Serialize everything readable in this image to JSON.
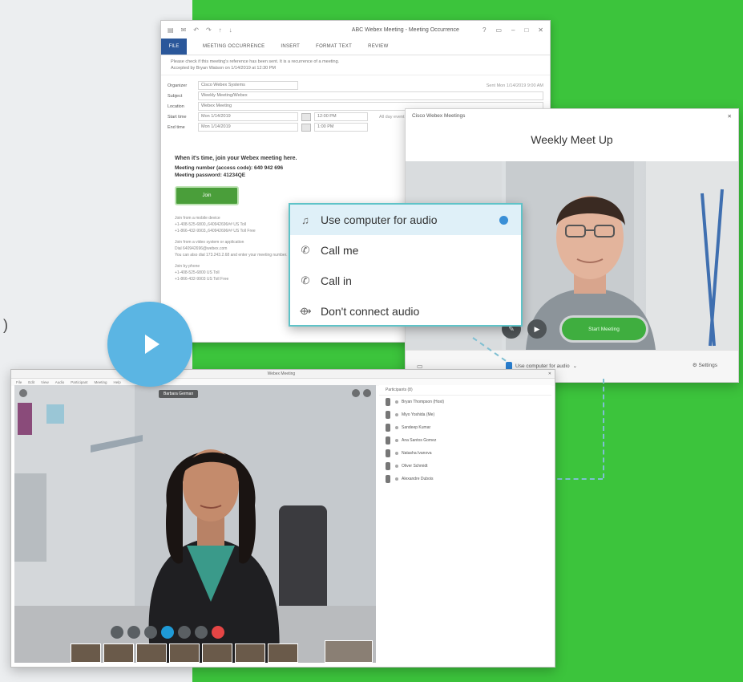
{
  "outlook": {
    "title": "ABC Webex Meeting  -  Meeting  Occurrence",
    "ribbon": {
      "file": "FILE",
      "tabs": [
        "MEETING OCCURRENCE",
        "INSERT",
        "FORMAT TEXT",
        "REVIEW"
      ]
    },
    "info_line1": "Please check if this meeting's reference has been sent. It is a recurrence of a meeting.",
    "info_line2": "Accepted by Bryan Watson on 1/14/2019 at 12:30 PM",
    "fields": [
      {
        "label": "Organizer",
        "value": "Cisco Webex Systems"
      },
      {
        "label": "Subject",
        "value": "Weekly Meeting/Webex"
      },
      {
        "label": "Location",
        "value": "Webex Meeting"
      }
    ],
    "start": {
      "label": "Start time",
      "date": "Mon 1/14/2019",
      "time": "12:00 PM",
      "extra": "All day event"
    },
    "end": {
      "label": "End time",
      "date": "Mon 1/14/2019",
      "time": "1:00 PM"
    },
    "sent": "Sent   Mon 1/14/2019 9:00 AM",
    "body": {
      "heading": "When it's time, join your Webex meeting here.",
      "meeting_number": "Meeting number (access code): 640 942 696",
      "meeting_password": "Meeting password: 41234QE",
      "join_label": "Join",
      "extra_lines": [
        "Join from a mobile device",
        "+1-408-525-6800,,640942696## US Toll",
        "+1-866-432-9903,,640942696## US Toll Free",
        "",
        "Join from a video system or application",
        "Dial 640942696@webex.com",
        "You can also dial 173.243.2.68 and enter your meeting number.",
        "",
        "Join by phone",
        "+1-408-525-6800 US Toll",
        "+1-866-432-9903 US Toll Free"
      ]
    }
  },
  "webex": {
    "window_title": "Cisco Webex Meetings",
    "meeting_title": "Weekly Meet Up",
    "start_button": "Start Meeting",
    "audio_status": "Use computer for audio",
    "settings": "Settings"
  },
  "audio_menu": {
    "items": [
      {
        "label": "Use computer for audio",
        "icon": "headset-icon",
        "glyph": "♫"
      },
      {
        "label": "Call me",
        "icon": "phone-callback-icon",
        "glyph": "✆"
      },
      {
        "label": "Call in",
        "icon": "phone-callin-icon",
        "glyph": "✆"
      },
      {
        "label": "Don't connect audio",
        "icon": "no-audio-icon",
        "glyph": "⟴"
      }
    ]
  },
  "meeting": {
    "window_title": "Webex Meeting",
    "menu": [
      "File",
      "Edit",
      "View",
      "Audio",
      "Participant",
      "Meeting",
      "Help"
    ],
    "speaker_label": "Barbara German",
    "participants_header": "Participants (8)",
    "participants": [
      "Bryan Thompson (Host)",
      "Miyo Yoshida (Me)",
      "Sandeep Kumar",
      "Ana Santos Gomez",
      "Natasha Ivanova",
      "Oliver Schmidt",
      "Alexandre Dubois"
    ]
  },
  "colors": {
    "green": "#3cc43c",
    "accent_blue": "#5bb5e3",
    "start_green": "#3fae3f"
  }
}
